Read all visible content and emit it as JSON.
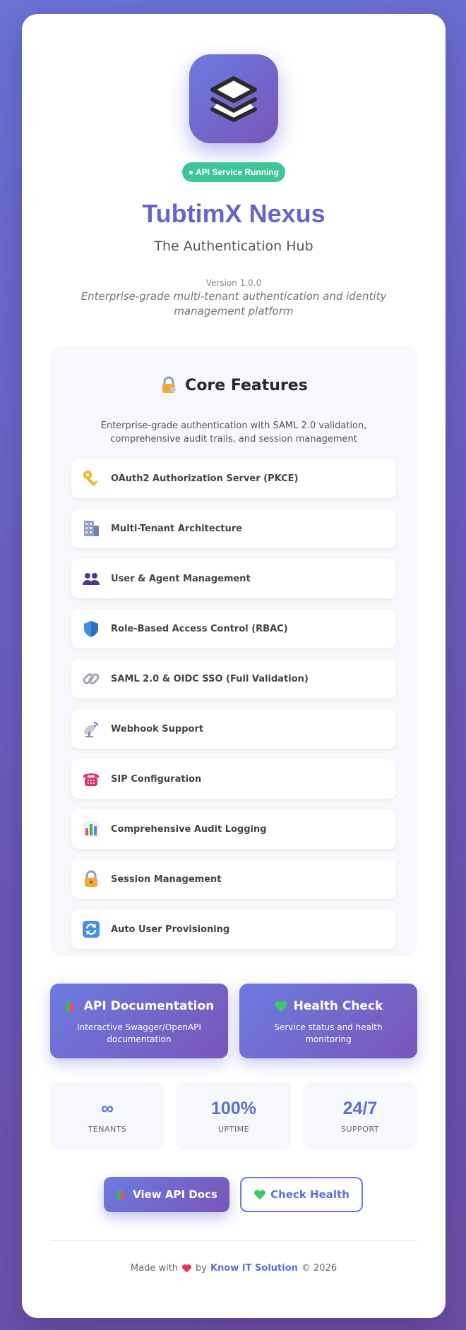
{
  "header": {
    "status_badge": "● API Service Running",
    "title": "TubtimX Nexus",
    "subtitle": "The Authentication Hub",
    "version": "Version 1.0.0",
    "tagline": "Enterprise-grade multi-tenant authentication and identity management platform"
  },
  "features": {
    "title": "Core Features",
    "description": "Enterprise-grade authentication with SAML 2.0 validation, comprehensive audit trails, and session management",
    "items": [
      {
        "label": "OAuth2 Authorization Server (PKCE)",
        "icon": "key-icon"
      },
      {
        "label": "Multi-Tenant Architecture",
        "icon": "office-building-icon"
      },
      {
        "label": "User & Agent Management",
        "icon": "users-icon"
      },
      {
        "label": "Role-Based Access Control (RBAC)",
        "icon": "shield-icon"
      },
      {
        "label": "SAML 2.0 & OIDC SSO (Full Validation)",
        "icon": "link-icon"
      },
      {
        "label": "Webhook Support",
        "icon": "satellite-dish-icon"
      },
      {
        "label": "SIP Configuration",
        "icon": "telephone-icon"
      },
      {
        "label": "Comprehensive Audit Logging",
        "icon": "bar-chart-icon"
      },
      {
        "label": "Session Management",
        "icon": "lock-icon"
      },
      {
        "label": "Auto User Provisioning",
        "icon": "refresh-icon"
      }
    ]
  },
  "links": {
    "api_docs": {
      "title": "API Documentation",
      "description": "Interactive Swagger/OpenAPI documentation"
    },
    "health": {
      "title": "Health Check",
      "description": "Service status and health monitoring"
    }
  },
  "stats": [
    {
      "value": "∞",
      "label": "TENANTS"
    },
    {
      "value": "100%",
      "label": "UPTIME"
    },
    {
      "value": "24/7",
      "label": "SUPPORT"
    }
  ],
  "buttons": {
    "view_docs": "View API Docs",
    "check_health": "Check Health"
  },
  "footer": {
    "made_with": "Made with",
    "by": "by",
    "company": "Know IT Solution",
    "copyright": "© 2026"
  },
  "colors": {
    "accent": "#6a63c9",
    "status_green": "#3fc59a",
    "link_blue": "#5a70d8"
  }
}
